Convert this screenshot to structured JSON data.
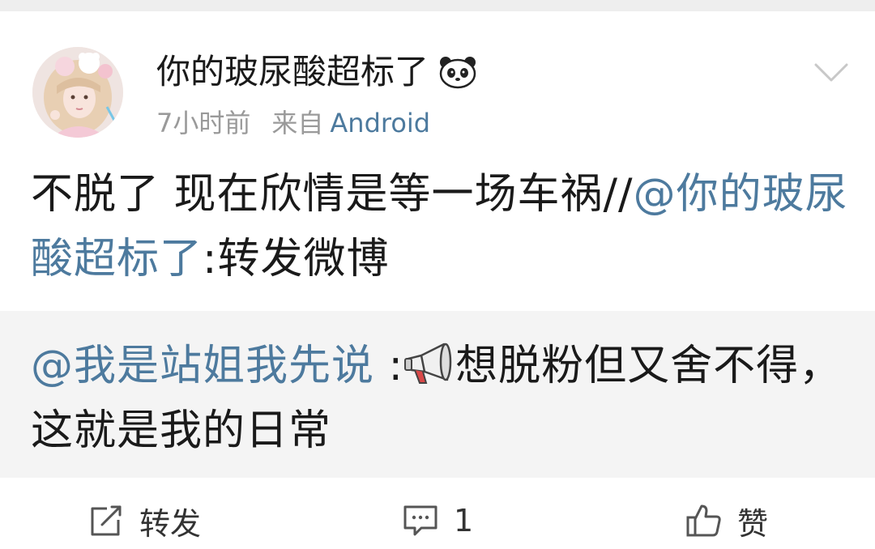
{
  "post": {
    "username": "你的玻尿酸超标了",
    "time": "7小时前",
    "from_label": "来自",
    "device": "Android",
    "text_main": "不脱了 现在欣情是等一场车祸//",
    "mention": "@你的玻尿酸超标了",
    "text_suffix": ":转发微博"
  },
  "repost": {
    "mention": "@我是站姐我先说",
    "separator": " :",
    "text": "想脱粉但又舍不得，这就是我的日常"
  },
  "actions": {
    "repost_label": "转发",
    "comment_count": "1",
    "like_label": "赞"
  },
  "colors": {
    "link": "#4d7a9e",
    "text": "#1a1a1a",
    "meta": "#9a9a9a",
    "repost_bg": "#f4f4f4"
  },
  "icons": {
    "emoji_name": "panda-icon",
    "repost_emoji": "megaphone-icon",
    "menu": "chevron-down-icon",
    "repost": "share-icon",
    "comment": "comment-icon",
    "like": "thumbs-up-icon"
  }
}
